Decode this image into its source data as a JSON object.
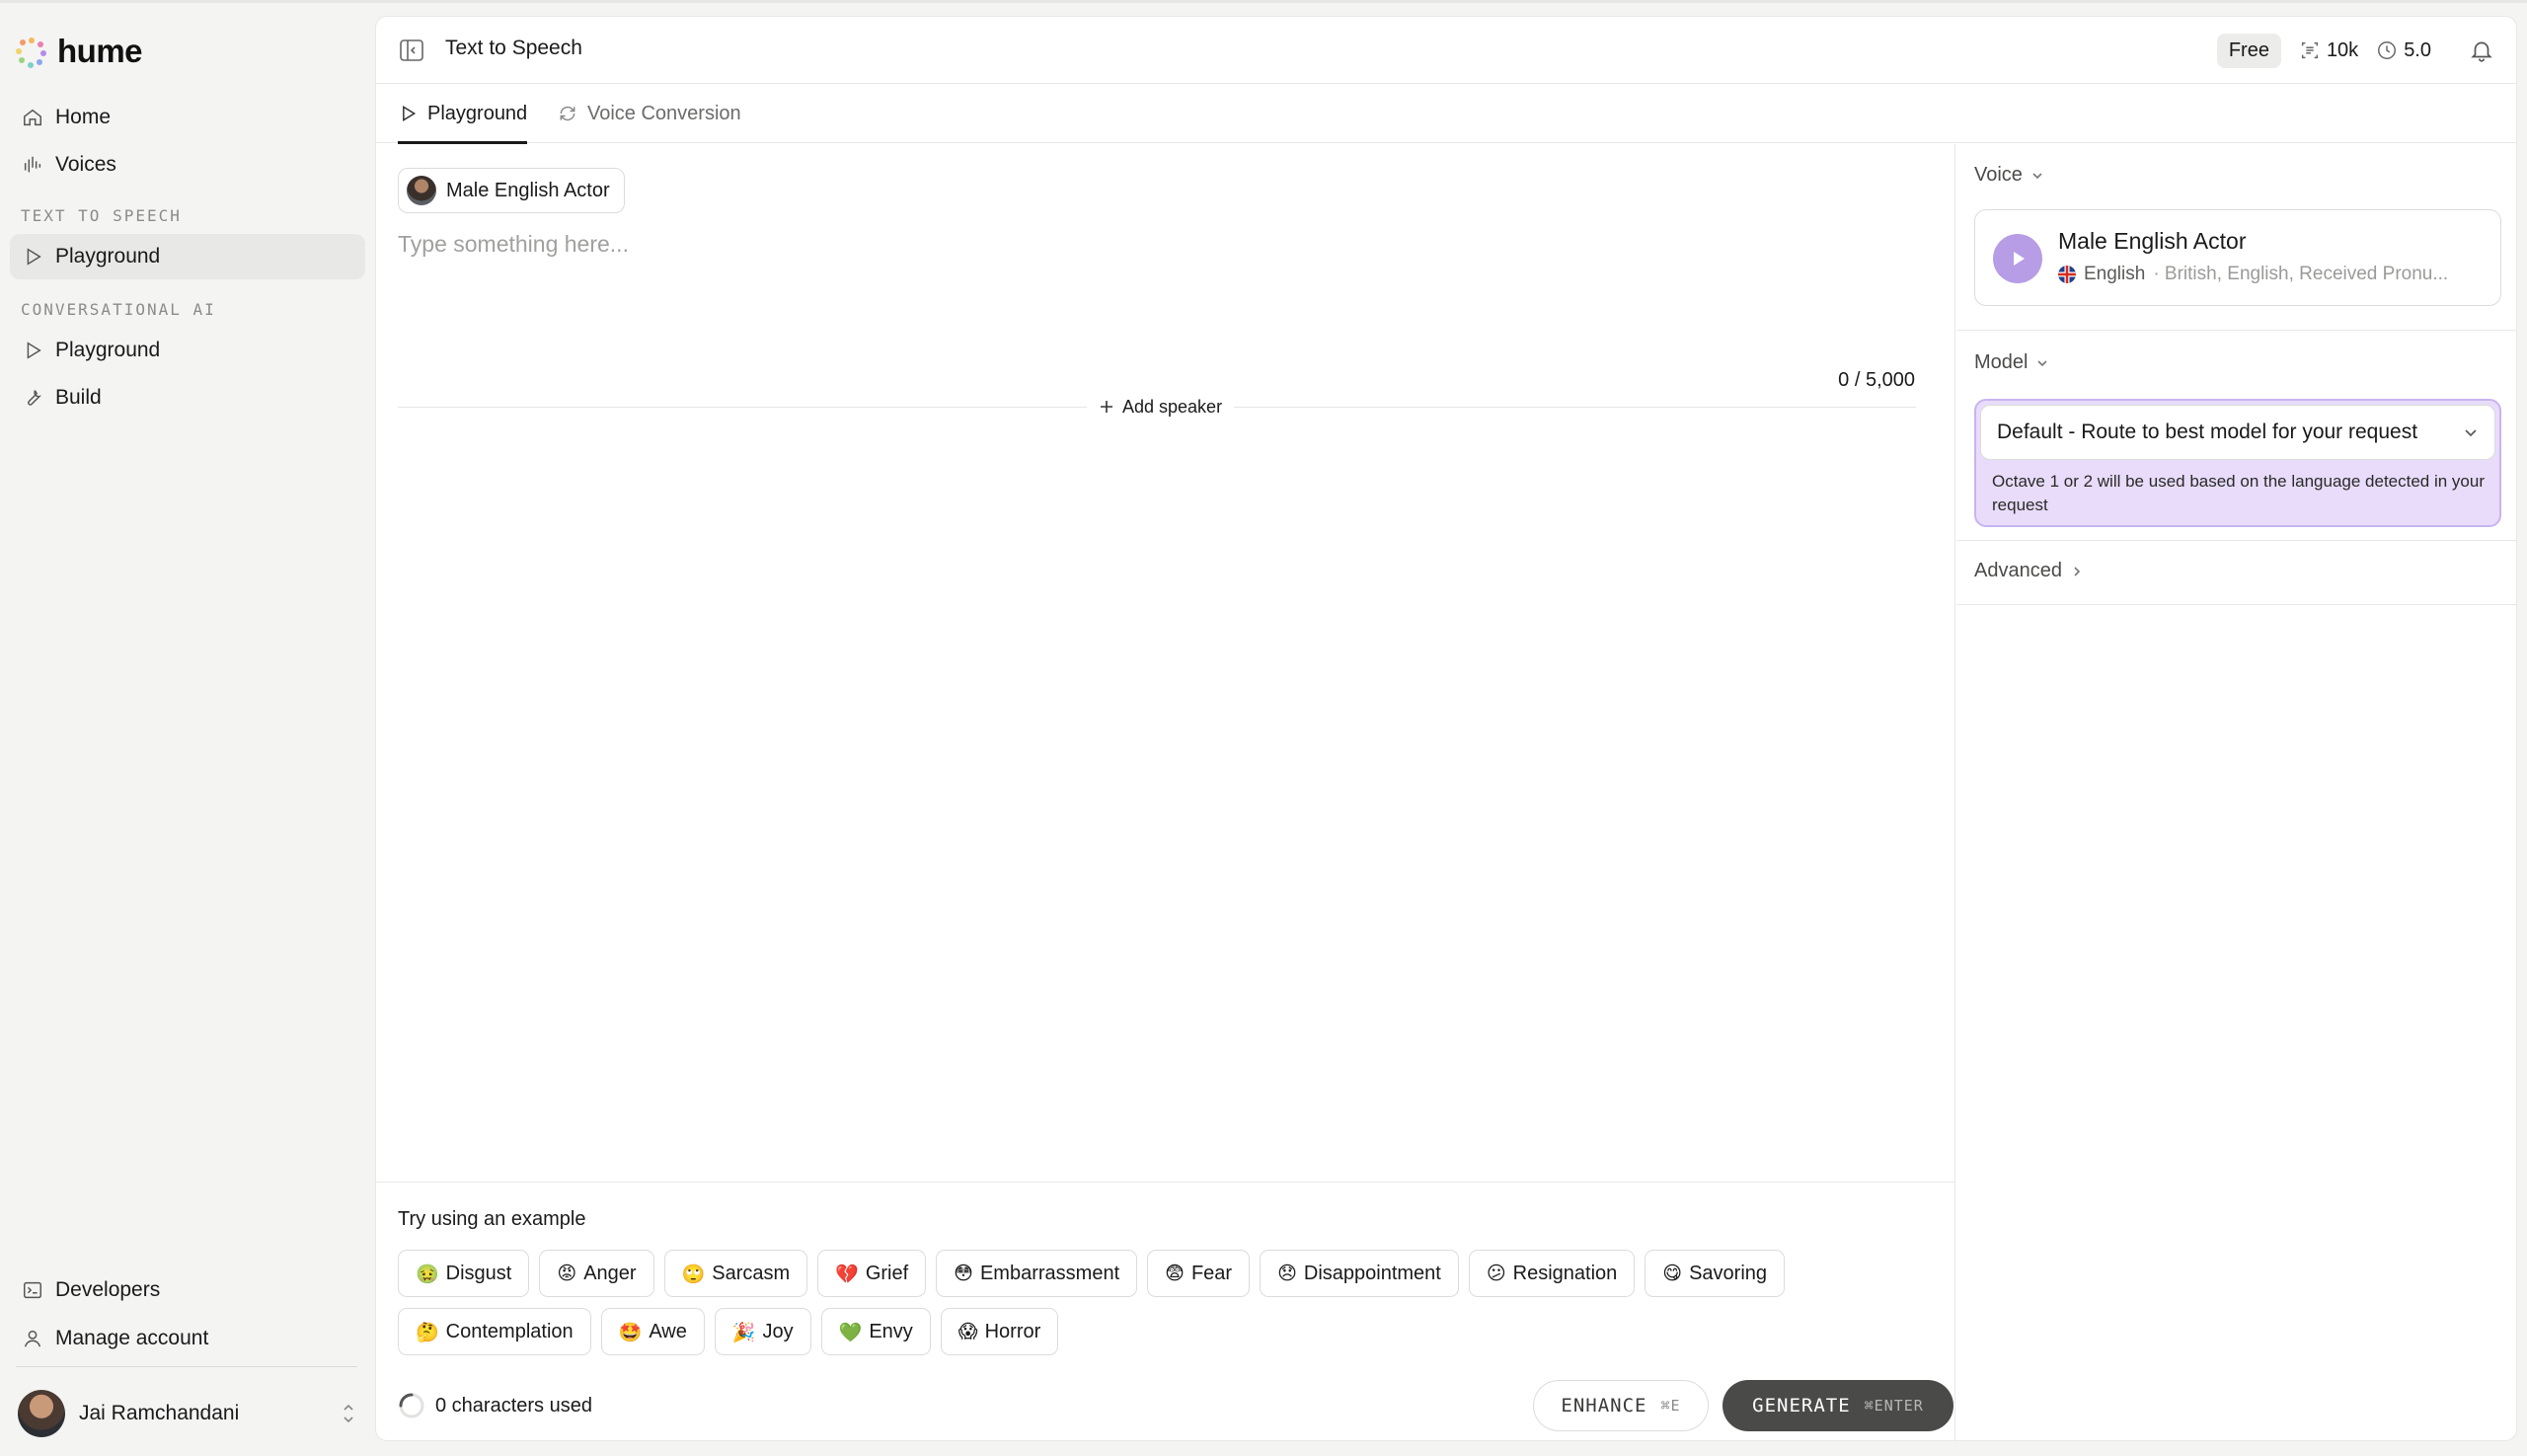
{
  "brand": {
    "name": "hume"
  },
  "sidebar": {
    "items": [
      {
        "label": "Home",
        "icon": "home-icon"
      },
      {
        "label": "Voices",
        "icon": "voices-icon"
      }
    ],
    "sections": [
      {
        "title": "TEXT TO SPEECH",
        "items": [
          {
            "label": "Playground",
            "icon": "play-icon",
            "active": true
          }
        ]
      },
      {
        "title": "CONVERSATIONAL AI",
        "items": [
          {
            "label": "Playground",
            "icon": "play-icon"
          },
          {
            "label": "Build",
            "icon": "wrench-icon"
          }
        ]
      }
    ],
    "bottom": [
      {
        "label": "Developers",
        "icon": "terminal-icon"
      },
      {
        "label": "Manage account",
        "icon": "user-icon"
      }
    ],
    "user": {
      "name": "Jai Ramchandani"
    }
  },
  "header": {
    "title": "Text to Speech",
    "plan": "Free",
    "credits": "10k",
    "usage_stat": "5.0"
  },
  "tabs": [
    {
      "label": "Playground",
      "active": true
    },
    {
      "label": "Voice Conversion",
      "active": false
    }
  ],
  "editor": {
    "speaker": "Male English Actor",
    "placeholder": "Type something here...",
    "char_count": "0 / 5,000",
    "add_speaker": "Add speaker"
  },
  "examples": {
    "title": "Try using an example",
    "row1": [
      {
        "emoji": "🤢",
        "label": "Disgust"
      },
      {
        "emoji": "😡",
        "label": "Anger"
      },
      {
        "emoji": "🙄",
        "label": "Sarcasm"
      },
      {
        "emoji": "💔",
        "label": "Grief"
      },
      {
        "emoji": "😳",
        "label": "Embarrassment"
      },
      {
        "emoji": "😨",
        "label": "Fear"
      },
      {
        "emoji": "😞",
        "label": "Disappointment"
      },
      {
        "emoji": "😕",
        "label": "Resignation"
      },
      {
        "emoji": "😋",
        "label": "Savoring"
      }
    ],
    "row2": [
      {
        "emoji": "🤔",
        "label": "Contemplation"
      },
      {
        "emoji": "🤩",
        "label": "Awe"
      },
      {
        "emoji": "🎉",
        "label": "Joy"
      },
      {
        "emoji": "💚",
        "label": "Envy"
      },
      {
        "emoji": "😱",
        "label": "Horror"
      }
    ]
  },
  "footer": {
    "usage": "0 characters used",
    "enhance_label": "ENHANCE",
    "enhance_shortcut": "⌘E",
    "generate_label": "GENERATE",
    "generate_shortcut": "⌘ENTER"
  },
  "settings": {
    "voice_label": "Voice",
    "voice": {
      "name": "Male English Actor",
      "language": "English",
      "description": "· British, English, Received Pronu..."
    },
    "model_label": "Model",
    "model": {
      "selected": "Default - Route to best model for your request",
      "note": "Octave 1 or 2 will be used based on the language detected in your request"
    },
    "advanced_label": "Advanced"
  },
  "colors": {
    "accent_purple": "#b79de6",
    "model_bg": "#e8dcfa",
    "generate_bg": "#4a4a48"
  }
}
